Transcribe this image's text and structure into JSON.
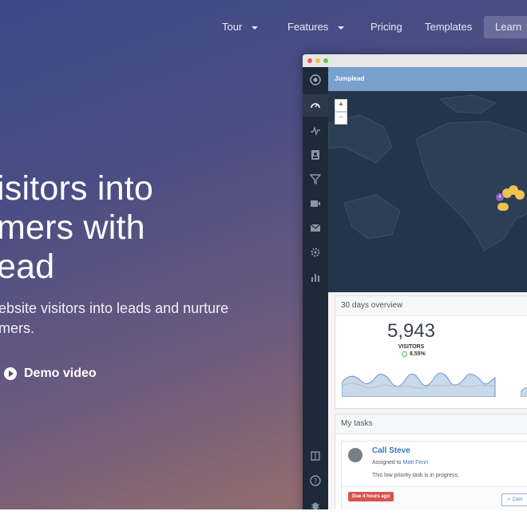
{
  "nav": {
    "items": [
      {
        "label": "Tour",
        "has_caret": true
      },
      {
        "label": "Features",
        "has_caret": true
      },
      {
        "label": "Pricing",
        "has_caret": false
      },
      {
        "label": "Templates",
        "has_caret": false
      },
      {
        "label": "Learn",
        "has_caret": false
      }
    ]
  },
  "hero": {
    "headline_lines": [
      "isitors into",
      "mers with",
      "ead"
    ],
    "subtext_lines": [
      "ebsite visitors into leads and nurture",
      "mers."
    ],
    "demo_label": "Demo video"
  },
  "app": {
    "title": "Jumplead",
    "sidebar_icons": [
      "logo-icon",
      "dashboard-icon",
      "activity-icon",
      "contacts-icon",
      "funnel-icon",
      "campaign-icon",
      "mail-icon",
      "settings-icon",
      "reports-icon",
      "book-icon",
      "help-icon",
      "bug-icon"
    ],
    "map": {
      "zoom_in": "+",
      "zoom_out": "−",
      "cluster_count": "4"
    },
    "overview": {
      "title": "30 days overview",
      "visitors_value": "5,943",
      "visitors_label": "VISITORS",
      "change": "8.55%"
    },
    "tasks": {
      "title": "My tasks",
      "task_name": "Call Steve",
      "assigned_prefix": "Assigned to",
      "assignee": "Matt Fenn",
      "description": "This low priority task is in progress.",
      "due": "Due 4 hours ago",
      "complete_label": "Com"
    }
  },
  "colors": {
    "accent_blue": "#7aa0cc",
    "due_red": "#d9534f",
    "sidebar": "#1f2a38",
    "map_bg": "#23354a",
    "pin_yellow": "#f2c14e"
  }
}
